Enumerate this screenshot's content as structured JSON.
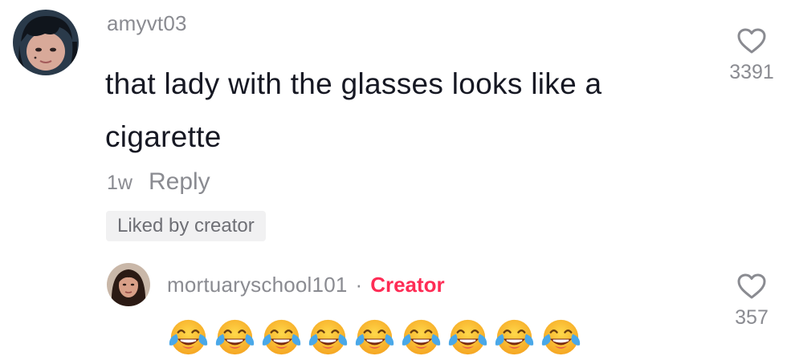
{
  "comment": {
    "username": "amyvt03",
    "text": "that lady with the glasses looks like a cigarette",
    "time": "1w",
    "reply_label": "Reply",
    "liked_badge": "Liked by creator",
    "like_count": "3391"
  },
  "reply": {
    "username": "mortuaryschool101",
    "separator": "·",
    "creator_label": "Creator",
    "emojis": [
      "joy",
      "joy",
      "joy",
      "joy",
      "joy",
      "joy",
      "joy",
      "joy",
      "joy"
    ],
    "like_count": "357"
  },
  "colors": {
    "text_primary": "#161823",
    "text_secondary": "#8a8b91",
    "creator_accent": "#fe2c55",
    "badge_bg": "#f1f1f2"
  },
  "icons": {
    "like": "heart-outline-icon",
    "emoji": "face-with-tears-of-joy-icon"
  }
}
